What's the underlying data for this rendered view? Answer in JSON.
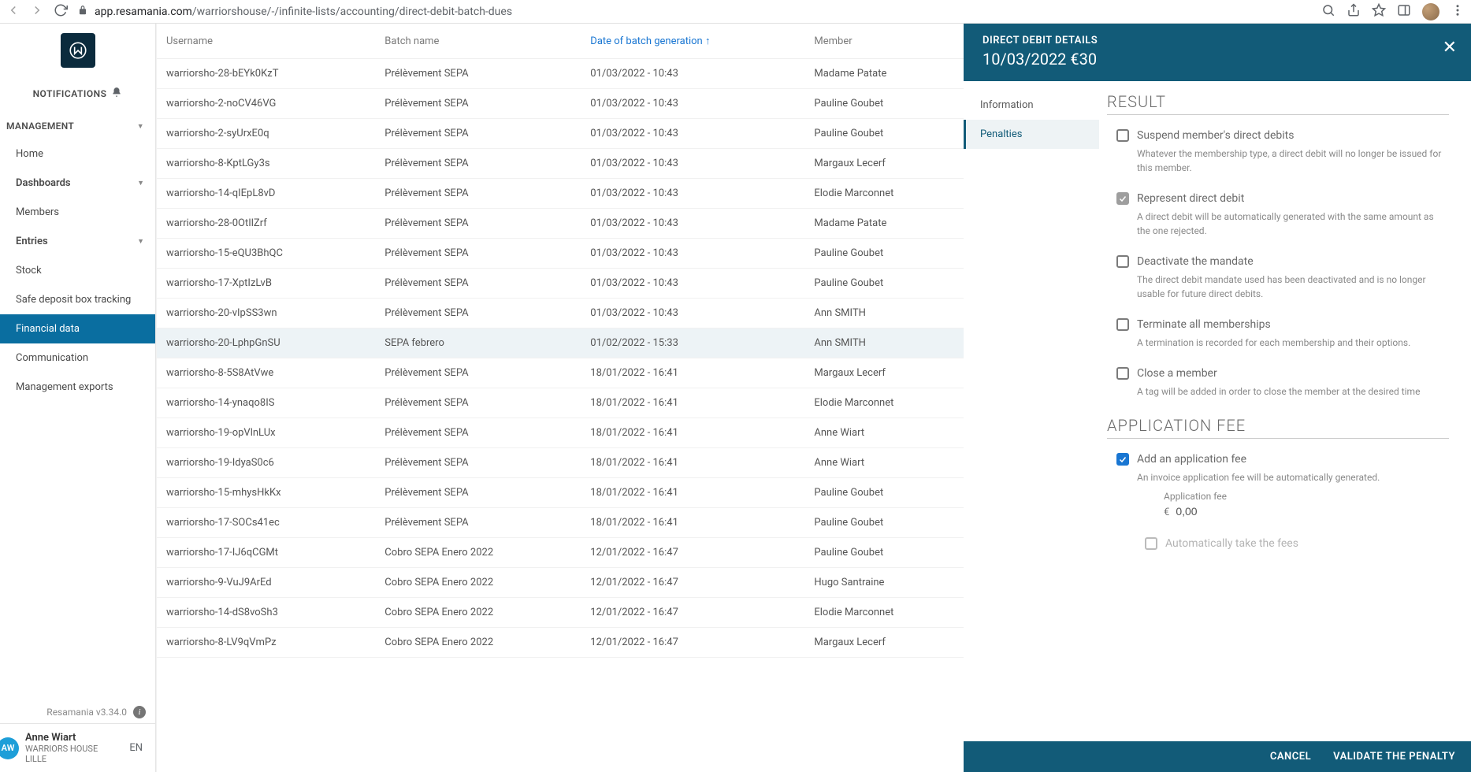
{
  "browser": {
    "url_domain": "app.resamania.com",
    "url_path": "/warriorshouse/-/infinite-lists/accounting/direct-debit-batch-dues"
  },
  "sidebar": {
    "notifications_label": "NOTIFICATIONS",
    "management_label": "MANAGEMENT",
    "items": [
      {
        "label": "Home",
        "expandable": false
      },
      {
        "label": "Dashboards",
        "expandable": true,
        "bold": true
      },
      {
        "label": "Members",
        "expandable": false
      },
      {
        "label": "Entries",
        "expandable": true,
        "bold": true
      },
      {
        "label": "Stock",
        "expandable": false
      },
      {
        "label": "Safe deposit box tracking",
        "expandable": false
      },
      {
        "label": "Financial data",
        "expandable": false,
        "active": true
      },
      {
        "label": "Communication",
        "expandable": false
      },
      {
        "label": "Management exports",
        "expandable": false
      }
    ],
    "version": "Resamania v3.34.0",
    "user": {
      "initials": "AW",
      "name": "Anne Wiart",
      "org": "WARRIORS HOUSE LILLE",
      "lang": "EN"
    }
  },
  "table": {
    "headers": {
      "username": "Username",
      "batch": "Batch name",
      "date": "Date of batch generation ↑",
      "member": "Member"
    },
    "rows": [
      {
        "username": "warriorsho-28-bEYk0KzT",
        "batch": "Prélèvement SEPA",
        "date": "01/03/2022 - 10:43",
        "member": "Madame Patate"
      },
      {
        "username": "warriorsho-2-noCV46VG",
        "batch": "Prélèvement SEPA",
        "date": "01/03/2022 - 10:43",
        "member": "Pauline Goubet"
      },
      {
        "username": "warriorsho-2-syUrxE0q",
        "batch": "Prélèvement SEPA",
        "date": "01/03/2022 - 10:43",
        "member": "Pauline Goubet"
      },
      {
        "username": "warriorsho-8-KptLGy3s",
        "batch": "Prélèvement SEPA",
        "date": "01/03/2022 - 10:43",
        "member": "Margaux Lecerf"
      },
      {
        "username": "warriorsho-14-qIEpL8vD",
        "batch": "Prélèvement SEPA",
        "date": "01/03/2022 - 10:43",
        "member": "Elodie Marconnet"
      },
      {
        "username": "warriorsho-28-0OtIlZrf",
        "batch": "Prélèvement SEPA",
        "date": "01/03/2022 - 10:43",
        "member": "Madame Patate"
      },
      {
        "username": "warriorsho-15-eQU3BhQC",
        "batch": "Prélèvement SEPA",
        "date": "01/03/2022 - 10:43",
        "member": "Pauline Goubet"
      },
      {
        "username": "warriorsho-17-XptIzLvB",
        "batch": "Prélèvement SEPA",
        "date": "01/03/2022 - 10:43",
        "member": "Pauline Goubet"
      },
      {
        "username": "warriorsho-20-vIpSS3wn",
        "batch": "Prélèvement SEPA",
        "date": "01/03/2022 - 10:43",
        "member": "Ann SMITH"
      },
      {
        "username": "warriorsho-20-LphpGnSU",
        "batch": "SEPA febrero",
        "date": "01/02/2022 - 15:33",
        "member": "Ann SMITH",
        "selected": true
      },
      {
        "username": "warriorsho-8-5S8AtVwe",
        "batch": "Prélèvement SEPA",
        "date": "18/01/2022 - 16:41",
        "member": "Margaux Lecerf"
      },
      {
        "username": "warriorsho-14-ynaqo8IS",
        "batch": "Prélèvement SEPA",
        "date": "18/01/2022 - 16:41",
        "member": "Elodie Marconnet"
      },
      {
        "username": "warriorsho-19-opVlnLUx",
        "batch": "Prélèvement SEPA",
        "date": "18/01/2022 - 16:41",
        "member": "Anne Wiart"
      },
      {
        "username": "warriorsho-19-IdyaS0c6",
        "batch": "Prélèvement SEPA",
        "date": "18/01/2022 - 16:41",
        "member": "Anne Wiart"
      },
      {
        "username": "warriorsho-15-mhysHkKx",
        "batch": "Prélèvement SEPA",
        "date": "18/01/2022 - 16:41",
        "member": "Pauline Goubet"
      },
      {
        "username": "warriorsho-17-SOCs41ec",
        "batch": "Prélèvement SEPA",
        "date": "18/01/2022 - 16:41",
        "member": "Pauline Goubet"
      },
      {
        "username": "warriorsho-17-IJ6qCGMt",
        "batch": "Cobro SEPA Enero 2022",
        "date": "12/01/2022 - 16:47",
        "member": "Pauline Goubet"
      },
      {
        "username": "warriorsho-9-VuJ9ArEd",
        "batch": "Cobro SEPA Enero 2022",
        "date": "12/01/2022 - 16:47",
        "member": "Hugo Santraine"
      },
      {
        "username": "warriorsho-14-dS8voSh3",
        "batch": "Cobro SEPA Enero 2022",
        "date": "12/01/2022 - 16:47",
        "member": "Elodie Marconnet"
      },
      {
        "username": "warriorsho-8-LV9qVmPz",
        "batch": "Cobro SEPA Enero 2022",
        "date": "12/01/2022 - 16:47",
        "member": "Margaux Lecerf"
      }
    ]
  },
  "detail": {
    "header_title": "DIRECT DEBIT DETAILS",
    "header_subtitle": "10/03/2022 €30",
    "nav": {
      "information": "Information",
      "penalties": "Penalties"
    },
    "result_title": "RESULT",
    "checks": [
      {
        "id": "suspend",
        "label": "Suspend member's direct debits",
        "desc": "Whatever the membership type, a direct debit will no longer be issued for this member.",
        "checked": false
      },
      {
        "id": "represent",
        "label": "Represent direct debit",
        "desc": "A direct debit will be automatically generated with the same amount as the one rejected.",
        "checked": true,
        "greyed": true
      },
      {
        "id": "deactivate",
        "label": "Deactivate the mandate",
        "desc": "The direct debit mandate used has been deactivated and is no longer usable for future direct debits.",
        "checked": false
      },
      {
        "id": "terminate",
        "label": "Terminate all memberships",
        "desc": "A termination is recorded for each membership and their options.",
        "checked": false
      },
      {
        "id": "close",
        "label": "Close a member",
        "desc": "A tag will be added in order to close the member at the desired time",
        "checked": false
      }
    ],
    "app_fee_title": "APPLICATION FEE",
    "app_fee_check": {
      "label": "Add an application fee",
      "desc": "An invoice application fee will be automatically generated.",
      "checked": true
    },
    "app_fee_field": {
      "label": "Application fee",
      "currency": "€",
      "value": "0,00"
    },
    "auto_take_label": "Automatically take the fees",
    "footer": {
      "cancel": "CANCEL",
      "validate": "VALIDATE THE PENALTY"
    }
  }
}
